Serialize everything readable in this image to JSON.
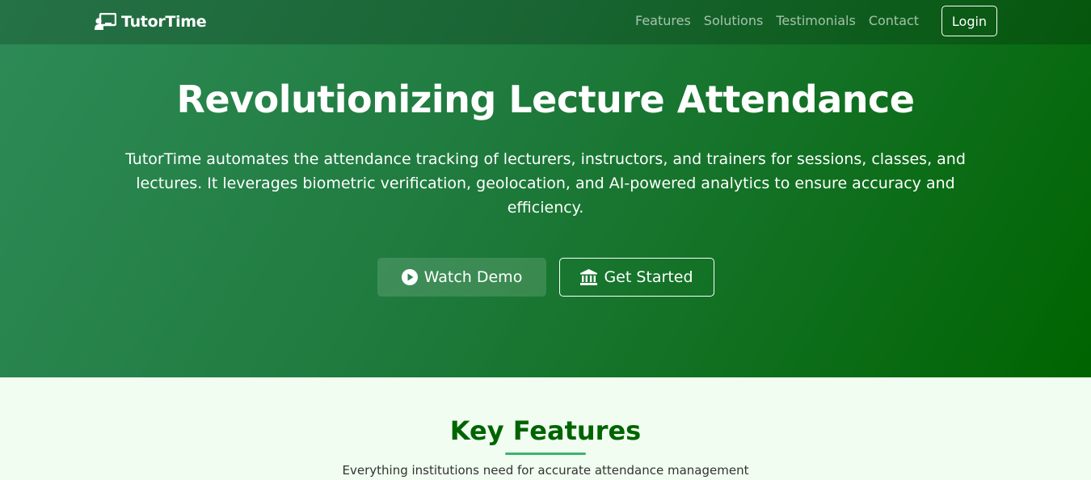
{
  "brand": {
    "name": "TutorTime",
    "icon": "chalkboard-teacher-icon"
  },
  "nav": {
    "links": [
      "Features",
      "Solutions",
      "Testimonials",
      "Contact"
    ],
    "login_label": "Login"
  },
  "hero": {
    "title": "Revolutionizing Lecture Attendance",
    "description": "TutorTime automates the attendance tracking of lecturers, instructors, and trainers for sessions, classes, and lectures. It leverages biometric verification, geolocation, and AI-powered analytics to ensure accuracy and efficiency.",
    "watch_demo_label": "Watch Demo",
    "watch_demo_icon": "play-circle-icon",
    "get_started_label": "Get Started",
    "get_started_icon": "university-icon"
  },
  "features": {
    "title": "Key Features",
    "subtitle": "Everything institutions need for accurate attendance management"
  },
  "colors": {
    "hero_start": "#2e8b57",
    "hero_end": "#006400",
    "section_bg": "#f0fdf0",
    "accent": "#3cb371",
    "heading_green": "#006400"
  }
}
